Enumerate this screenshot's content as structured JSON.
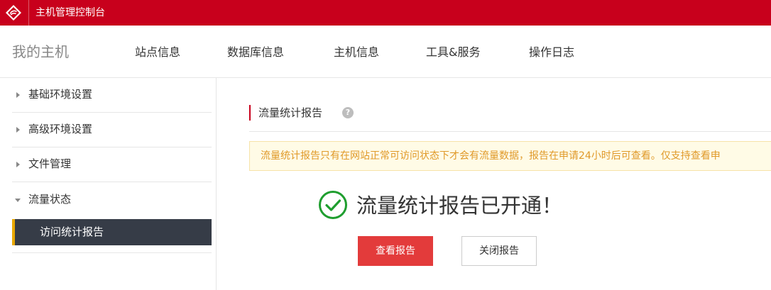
{
  "topbar": {
    "title": "主机管理控制台",
    "accent_color": "#c8001c",
    "logo_icon": "brand-logo-icon"
  },
  "navbar": {
    "brand": "我的主机",
    "items": [
      {
        "label": "站点信息"
      },
      {
        "label": "数据库信息"
      },
      {
        "label": "主机信息"
      },
      {
        "label": "工具&服务"
      },
      {
        "label": "操作日志"
      }
    ]
  },
  "sidebar": {
    "items": [
      {
        "label": "基础环境设置",
        "icon": "caret-right-icon"
      },
      {
        "label": "高级环境设置",
        "icon": "caret-right-icon"
      },
      {
        "label": "文件管理",
        "icon": "caret-right-icon"
      },
      {
        "label": "流量状态",
        "icon": "caret-down-icon",
        "expanded": true
      }
    ],
    "subitems": [
      {
        "label": "访问统计报告",
        "active": true
      }
    ],
    "active_bg": "#363c47",
    "active_accent": "#e9a800"
  },
  "main": {
    "section_title": "流量统计报告",
    "help_icon": "question-circle-icon",
    "help_glyph": "?",
    "notice": "流量统计报告只有在网站正常可访问状态下才会有流量数据，报告在申请24小时后可查看。仅支持查看申",
    "success_icon": "check-circle-icon",
    "success_message": "流量统计报告已开通！",
    "buttons": {
      "view_report": "查看报告",
      "close_report": "关闭报告"
    },
    "success_color": "#1f9e2f",
    "primary_button_color": "#e33b3b"
  }
}
